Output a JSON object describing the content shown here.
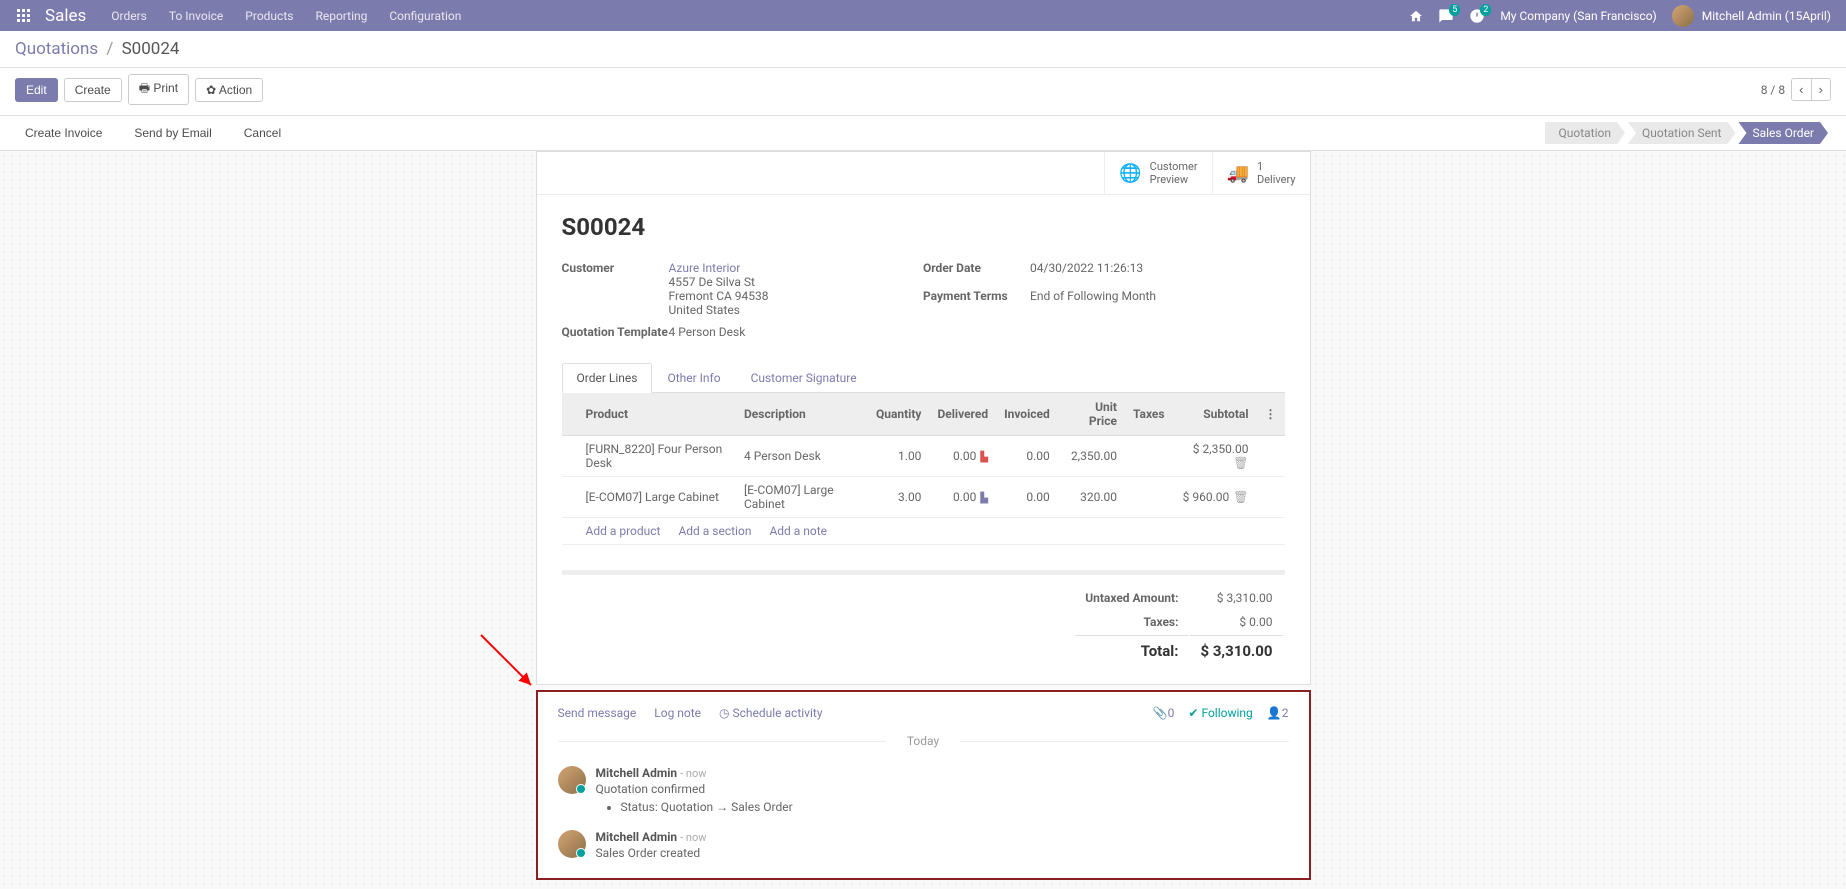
{
  "navbar": {
    "brand": "Sales",
    "menu": [
      "Orders",
      "To Invoice",
      "Products",
      "Reporting",
      "Configuration"
    ],
    "messages_badge": "5",
    "activity_badge": "2",
    "company": "My Company (San Francisco)",
    "user": "Mitchell Admin (15April)"
  },
  "breadcrumb": {
    "parent": "Quotations",
    "current": "S00024"
  },
  "toolbar": {
    "edit": "Edit",
    "create": "Create",
    "print": "Print",
    "action": "Action"
  },
  "pager": {
    "text": "8 / 8"
  },
  "status_buttons": {
    "create_invoice": "Create Invoice",
    "send_email": "Send by Email",
    "cancel": "Cancel"
  },
  "status_steps": {
    "quotation": "Quotation",
    "quotation_sent": "Quotation Sent",
    "sales_order": "Sales Order"
  },
  "stat_buttons": {
    "preview": {
      "line1": "Customer",
      "line2": "Preview"
    },
    "delivery": {
      "count": "1",
      "label": "Delivery"
    }
  },
  "record": {
    "title": "S00024",
    "customer_label": "Customer",
    "customer_name": "Azure Interior",
    "customer_addr1": "4557 De Silva St",
    "customer_addr2": "Fremont CA 94538",
    "customer_addr3": "United States",
    "template_label": "Quotation Template",
    "template_value": "4 Person Desk",
    "order_date_label": "Order Date",
    "order_date_value": "04/30/2022 11:26:13",
    "payment_terms_label": "Payment Terms",
    "payment_terms_value": "End of Following Month"
  },
  "tabs": {
    "order_lines": "Order Lines",
    "other_info": "Other Info",
    "customer_signature": "Customer Signature"
  },
  "table": {
    "headers": {
      "product": "Product",
      "description": "Description",
      "quantity": "Quantity",
      "delivered": "Delivered",
      "invoiced": "Invoiced",
      "unit_price": "Unit Price",
      "taxes": "Taxes",
      "subtotal": "Subtotal"
    },
    "rows": [
      {
        "product": "[FURN_8220] Four Person Desk",
        "description": "4 Person Desk",
        "quantity": "1.00",
        "delivered": "0.00",
        "invoiced": "0.00",
        "unit_price": "2,350.00",
        "taxes": "",
        "subtotal": "$ 2,350.00"
      },
      {
        "product": "[E-COM07] Large Cabinet",
        "description": "[E-COM07] Large Cabinet",
        "quantity": "3.00",
        "delivered": "0.00",
        "invoiced": "0.00",
        "unit_price": "320.00",
        "taxes": "",
        "subtotal": "$ 960.00"
      }
    ],
    "actions": {
      "add_product": "Add a product",
      "add_section": "Add a section",
      "add_note": "Add a note"
    }
  },
  "totals": {
    "untaxed_label": "Untaxed Amount:",
    "untaxed_value": "$ 3,310.00",
    "taxes_label": "Taxes:",
    "taxes_value": "$ 0.00",
    "total_label": "Total:",
    "total_value": "$ 3,310.00"
  },
  "chatter": {
    "send_message": "Send message",
    "log_note": "Log note",
    "schedule_activity": "Schedule activity",
    "attachments": "0",
    "following": "Following",
    "followers": "2",
    "separator": "Today",
    "messages": [
      {
        "author": "Mitchell Admin",
        "time": "- now",
        "text": "Quotation confirmed",
        "detail": "Status: Quotation → Sales Order"
      },
      {
        "author": "Mitchell Admin",
        "time": "- now",
        "text": "Sales Order created",
        "detail": ""
      }
    ]
  }
}
